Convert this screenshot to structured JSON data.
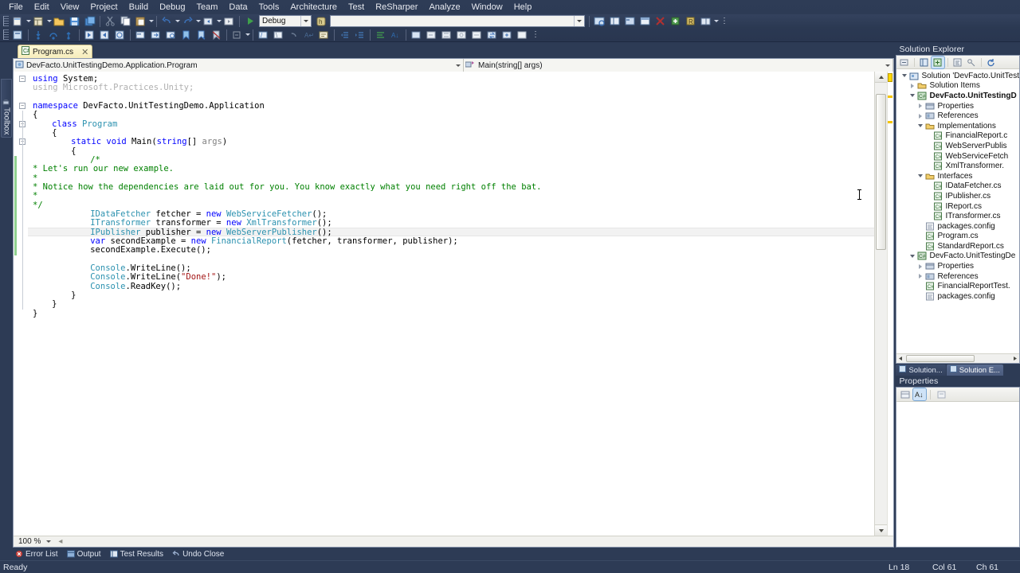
{
  "menubar": {
    "items": [
      "File",
      "Edit",
      "View",
      "Project",
      "Build",
      "Debug",
      "Team",
      "Data",
      "Tools",
      "Architecture",
      "Test",
      "ReSharper",
      "Analyze",
      "Window",
      "Help"
    ]
  },
  "toolbar": {
    "config_combo": "Debug",
    "find_combo": "",
    "overflow": "⋮"
  },
  "toolbox": {
    "label": "Toolbox"
  },
  "editor": {
    "tab_label": "Program.cs",
    "tab_close": "✕",
    "nav_type": "DevFacto.UnitTestingDemo.Application.Program",
    "nav_member": "Main(string[] args)",
    "zoom_level": "100 %",
    "code_lines": [
      {
        "indent": 0,
        "segments": [
          {
            "t": "using ",
            "c": "kw"
          },
          {
            "t": "System;",
            "c": ""
          }
        ]
      },
      {
        "indent": 0,
        "segments": [
          {
            "t": "using Microsoft.Practices.Unity;",
            "c": "gray"
          }
        ]
      },
      {
        "indent": 0,
        "segments": [
          {
            "t": "",
            "c": ""
          }
        ]
      },
      {
        "indent": 0,
        "segments": [
          {
            "t": "namespace ",
            "c": "kw"
          },
          {
            "t": "DevFacto.UnitTestingDemo.Application",
            "c": ""
          }
        ]
      },
      {
        "indent": 0,
        "segments": [
          {
            "t": "{",
            "c": ""
          }
        ]
      },
      {
        "indent": 4,
        "segments": [
          {
            "t": "class ",
            "c": "kw"
          },
          {
            "t": "Program",
            "c": "type"
          }
        ]
      },
      {
        "indent": 4,
        "segments": [
          {
            "t": "{",
            "c": ""
          }
        ]
      },
      {
        "indent": 8,
        "segments": [
          {
            "t": "static ",
            "c": "kw"
          },
          {
            "t": "void ",
            "c": "kw"
          },
          {
            "t": "Main(",
            "c": ""
          },
          {
            "t": "string",
            "c": "kw"
          },
          {
            "t": "[] ",
            "c": ""
          },
          {
            "t": "args",
            "c": "param"
          },
          {
            "t": ")",
            "c": ""
          }
        ]
      },
      {
        "indent": 8,
        "segments": [
          {
            "t": "{",
            "c": ""
          }
        ]
      },
      {
        "indent": 12,
        "segments": [
          {
            "t": "/*",
            "c": "cmt"
          }
        ]
      },
      {
        "indent": 0,
        "segments": [
          {
            "t": "* Let's run our new example.",
            "c": "cmt"
          }
        ]
      },
      {
        "indent": 0,
        "segments": [
          {
            "t": "*",
            "c": "cmt"
          }
        ]
      },
      {
        "indent": 0,
        "segments": [
          {
            "t": "* Notice how the dependencies are laid out for you. You know exactly what you need right off the bat.",
            "c": "cmt"
          }
        ]
      },
      {
        "indent": 0,
        "segments": [
          {
            "t": "*",
            "c": "cmt"
          }
        ]
      },
      {
        "indent": 0,
        "segments": [
          {
            "t": "*/",
            "c": "cmt"
          }
        ]
      },
      {
        "indent": 12,
        "segments": [
          {
            "t": "IDataFetcher",
            "c": "type"
          },
          {
            "t": " fetcher = ",
            "c": ""
          },
          {
            "t": "new ",
            "c": "kw"
          },
          {
            "t": "WebServiceFetcher",
            "c": "type"
          },
          {
            "t": "();",
            "c": ""
          }
        ]
      },
      {
        "indent": 12,
        "segments": [
          {
            "t": "ITransformer",
            "c": "type"
          },
          {
            "t": " transformer = ",
            "c": ""
          },
          {
            "t": "new ",
            "c": "kw"
          },
          {
            "t": "XmlTransformer",
            "c": "type"
          },
          {
            "t": "();",
            "c": ""
          }
        ]
      },
      {
        "indent": 12,
        "segments": [
          {
            "t": "IPublisher",
            "c": "type"
          },
          {
            "t": " publisher = ",
            "c": ""
          },
          {
            "t": "new ",
            "c": "kw"
          },
          {
            "t": "WebServerPublisher",
            "c": "type"
          },
          {
            "t": "();",
            "c": ""
          }
        ],
        "highlight": true
      },
      {
        "indent": 12,
        "segments": [
          {
            "t": "var",
            "c": "kw"
          },
          {
            "t": " secondExample = ",
            "c": ""
          },
          {
            "t": "new ",
            "c": "kw"
          },
          {
            "t": "FinancialReport",
            "c": "type"
          },
          {
            "t": "(fetcher, transformer, publisher);",
            "c": ""
          }
        ]
      },
      {
        "indent": 12,
        "segments": [
          {
            "t": "secondExample.Execute();",
            "c": ""
          }
        ]
      },
      {
        "indent": 0,
        "segments": [
          {
            "t": "",
            "c": ""
          }
        ]
      },
      {
        "indent": 12,
        "segments": [
          {
            "t": "Console",
            "c": "type"
          },
          {
            "t": ".WriteLine();",
            "c": ""
          }
        ]
      },
      {
        "indent": 12,
        "segments": [
          {
            "t": "Console",
            "c": "type"
          },
          {
            "t": ".WriteLine(",
            "c": ""
          },
          {
            "t": "\"Done!\"",
            "c": "str"
          },
          {
            "t": ");",
            "c": ""
          }
        ]
      },
      {
        "indent": 12,
        "segments": [
          {
            "t": "Console",
            "c": "type"
          },
          {
            "t": ".ReadKey();",
            "c": ""
          }
        ]
      },
      {
        "indent": 8,
        "segments": [
          {
            "t": "}",
            "c": ""
          }
        ]
      },
      {
        "indent": 4,
        "segments": [
          {
            "t": "}",
            "c": ""
          }
        ]
      },
      {
        "indent": 0,
        "segments": [
          {
            "t": "}",
            "c": ""
          }
        ]
      }
    ]
  },
  "solution_explorer": {
    "title": "Solution Explorer",
    "tree": [
      {
        "depth": 0,
        "expander": "expanded",
        "icon": "solution-icon",
        "label": "Solution 'DevFacto.UnitTest",
        "bold": false
      },
      {
        "depth": 1,
        "expander": "collapsed",
        "icon": "folder-icon",
        "label": "Solution Items",
        "bold": false
      },
      {
        "depth": 1,
        "expander": "expanded",
        "icon": "csproj-icon",
        "label": "DevFacto.UnitTestingD",
        "bold": true
      },
      {
        "depth": 2,
        "expander": "collapsed",
        "icon": "properties-icon",
        "label": "Properties",
        "bold": false
      },
      {
        "depth": 2,
        "expander": "collapsed",
        "icon": "references-icon",
        "label": "References",
        "bold": false
      },
      {
        "depth": 2,
        "expander": "expanded",
        "icon": "folder-icon",
        "label": "Implementations",
        "bold": false
      },
      {
        "depth": 3,
        "expander": "none",
        "icon": "csfile-icon",
        "label": "FinancialReport.c",
        "bold": false
      },
      {
        "depth": 3,
        "expander": "none",
        "icon": "csfile-icon",
        "label": "WebServerPublis",
        "bold": false
      },
      {
        "depth": 3,
        "expander": "none",
        "icon": "csfile-icon",
        "label": "WebServiceFetch",
        "bold": false
      },
      {
        "depth": 3,
        "expander": "none",
        "icon": "csfile-icon",
        "label": "XmlTransformer.",
        "bold": false
      },
      {
        "depth": 2,
        "expander": "expanded",
        "icon": "folder-icon",
        "label": "Interfaces",
        "bold": false
      },
      {
        "depth": 3,
        "expander": "none",
        "icon": "csfile-icon",
        "label": "IDataFetcher.cs",
        "bold": false
      },
      {
        "depth": 3,
        "expander": "none",
        "icon": "csfile-icon",
        "label": "IPublisher.cs",
        "bold": false
      },
      {
        "depth": 3,
        "expander": "none",
        "icon": "csfile-icon",
        "label": "IReport.cs",
        "bold": false
      },
      {
        "depth": 3,
        "expander": "none",
        "icon": "csfile-icon",
        "label": "ITransformer.cs",
        "bold": false
      },
      {
        "depth": 2,
        "expander": "none",
        "icon": "config-icon",
        "label": "packages.config",
        "bold": false
      },
      {
        "depth": 2,
        "expander": "none",
        "icon": "csfile-icon",
        "label": "Program.cs",
        "bold": false
      },
      {
        "depth": 2,
        "expander": "none",
        "icon": "csfile-icon",
        "label": "StandardReport.cs",
        "bold": false
      },
      {
        "depth": 1,
        "expander": "expanded",
        "icon": "testproj-icon",
        "label": "DevFacto.UnitTestingDe",
        "bold": false
      },
      {
        "depth": 2,
        "expander": "collapsed",
        "icon": "properties-icon",
        "label": "Properties",
        "bold": false
      },
      {
        "depth": 2,
        "expander": "collapsed",
        "icon": "references-icon",
        "label": "References",
        "bold": false
      },
      {
        "depth": 2,
        "expander": "none",
        "icon": "csfile-icon",
        "label": "FinancialReportTest.",
        "bold": false
      },
      {
        "depth": 2,
        "expander": "none",
        "icon": "config-icon",
        "label": "packages.config",
        "bold": false
      }
    ]
  },
  "dock_tabs": [
    {
      "label": "Solution...",
      "icon": "properties-tab-icon",
      "selected": false
    },
    {
      "label": "Solution E...",
      "icon": "solution-tab-icon",
      "selected": true
    }
  ],
  "properties_panel": {
    "title": "Properties"
  },
  "bottom_tabs": [
    {
      "label": "Error List",
      "icon": "error-list-icon"
    },
    {
      "label": "Output",
      "icon": "output-icon"
    },
    {
      "label": "Test Results",
      "icon": "test-results-icon"
    },
    {
      "label": "Undo Close",
      "icon": "undo-close-icon"
    }
  ],
  "statusbar": {
    "ready": "Ready",
    "line": "Ln 18",
    "col": "Col 61",
    "ch": "Ch 61"
  },
  "colors": {
    "chrome": "#2d3b55",
    "accent_tab": "#f6edbd",
    "keyword": "#0000ff",
    "type": "#2b91af",
    "string": "#a31515",
    "comment": "#008000",
    "changebar": "#8fd18f",
    "marker": "#f5c400"
  }
}
